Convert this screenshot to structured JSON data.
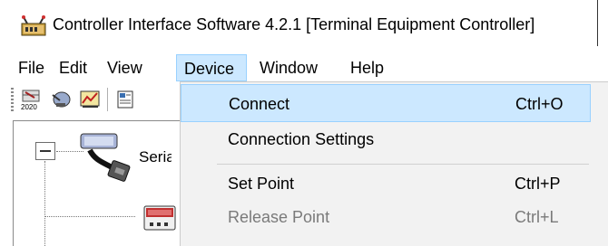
{
  "window": {
    "title": "Controller Interface Software 4.2.1 [Terminal Equipment Controller]"
  },
  "menubar": {
    "items": [
      {
        "label": "File"
      },
      {
        "label": "Edit"
      },
      {
        "label": "View"
      },
      {
        "label": "Device"
      },
      {
        "label": "Window"
      },
      {
        "label": "Help"
      }
    ],
    "active": "Device"
  },
  "toolbar": {
    "year_label": "2020"
  },
  "tree": {
    "serial_label": "Serial"
  },
  "device_menu": {
    "items": [
      {
        "label": "Connect",
        "shortcut": "Ctrl+O",
        "state": "hover"
      },
      {
        "label": "Connection Settings",
        "shortcut": "",
        "state": "normal"
      },
      {
        "label": "Set Point",
        "shortcut": "Ctrl+P",
        "state": "normal"
      },
      {
        "label": "Release Point",
        "shortcut": "Ctrl+L",
        "state": "disabled"
      }
    ]
  },
  "colors": {
    "highlight_fill": "#cce8ff",
    "highlight_border": "#99d1ff",
    "menu_background": "#f2f2f2",
    "disabled_text": "#7a7a7a"
  }
}
